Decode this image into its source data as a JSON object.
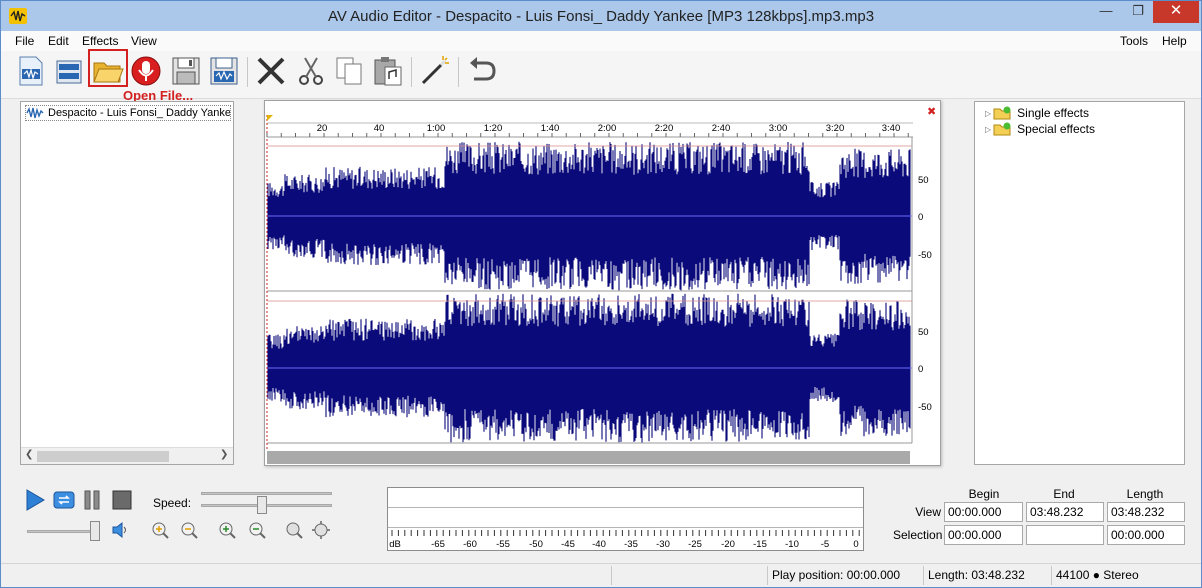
{
  "window": {
    "title": "AV Audio Editor - Despacito - Luis Fonsi_ Daddy Yankee [MP3 128kbps].mp3.mp3",
    "minimize": "—",
    "maximize": "❐",
    "close": "✕"
  },
  "menu": {
    "left": [
      "File",
      "Edit",
      "Effects",
      "View"
    ],
    "right": [
      "Tools",
      "Help"
    ]
  },
  "toolbar": {
    "open_file_label": "Open File..."
  },
  "files": {
    "items": [
      "Despacito - Luis Fonsi_ Daddy Yankee"
    ]
  },
  "waveform": {
    "close_glyph": "✖",
    "time_ticks": [
      "20",
      "40",
      "1:00",
      "1:20",
      "1:40",
      "2:00",
      "2:20",
      "2:40",
      "3:00",
      "3:20",
      "3:40"
    ],
    "amp_ticks_top": [
      "50",
      "0",
      "-50"
    ],
    "amp_ticks_bottom": [
      "50",
      "0",
      "-50"
    ]
  },
  "effects": {
    "items": [
      "Single effects",
      "Special effects"
    ]
  },
  "playback": {
    "speed_label": "Speed:"
  },
  "level_meter": {
    "db_labels": [
      "dB",
      "-65",
      "-60",
      "-55",
      "-50",
      "-45",
      "-40",
      "-35",
      "-30",
      "-25",
      "-20",
      "-15",
      "-10",
      "-5",
      "0"
    ]
  },
  "time_panel": {
    "headers": [
      "Begin",
      "End",
      "Length"
    ],
    "view_label": "View",
    "selection_label": "Selection",
    "view_begin": "00:00.000",
    "view_end": "03:48.232",
    "view_length": "03:48.232",
    "selection_begin": "00:00.000",
    "selection_end": "",
    "selection_length": "00:00.000"
  },
  "status": {
    "play_position": "Play position: 00:00.000",
    "length": "Length: 03:48.232",
    "format": "44100 ● Stereo"
  },
  "colors": {
    "waveform": "#0a0a7a",
    "title_bar": "#abc7e9",
    "highlight": "#d32020"
  }
}
